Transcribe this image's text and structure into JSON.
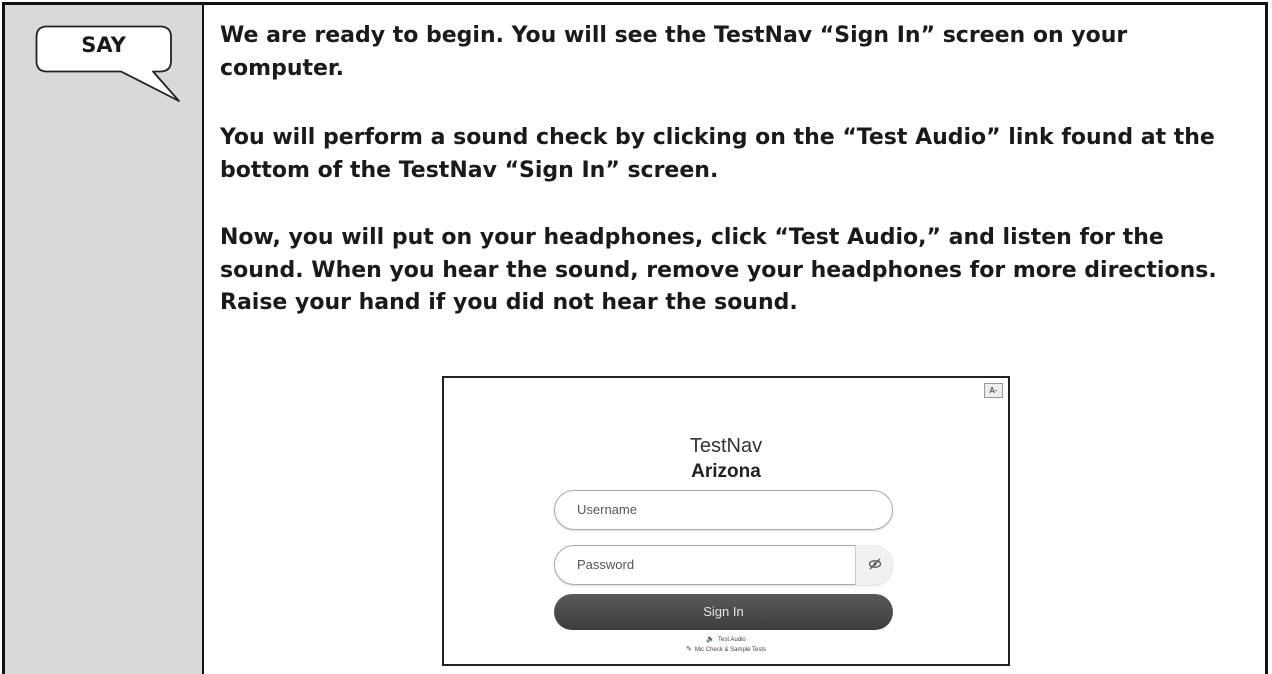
{
  "say_box": {
    "label": "SAY",
    "paragraphs": [
      "We are ready to begin. You will see the TestNav “Sign In” screen on your computer.",
      "You will perform a sound check by clicking on the “Test Audio” link found at the bottom of the TestNav “Sign In” screen.",
      "Now, you will put on your headphones, click “Test Audio,” and listen for the sound. When you hear the sound, remove your headphones for more directions. Raise your hand if you did not hear the sound."
    ]
  },
  "screenshot": {
    "font_button": "A-",
    "brand": "TestNav",
    "state": "Arizona",
    "username_placeholder": "Username",
    "password_placeholder": "Password",
    "password_toggle_icon": "eye-slash-icon",
    "sign_in_label": "Sign In",
    "test_audio_label": "Test Audio",
    "test_audio_icon": "speaker-icon",
    "mic_check_label": "Mic Check & Sample Tests",
    "mic_check_icon": "mic-icon"
  },
  "colors": {
    "left_column_bg": "#d9d9d9",
    "sign_in_button_bg": "#4a4a4a"
  }
}
